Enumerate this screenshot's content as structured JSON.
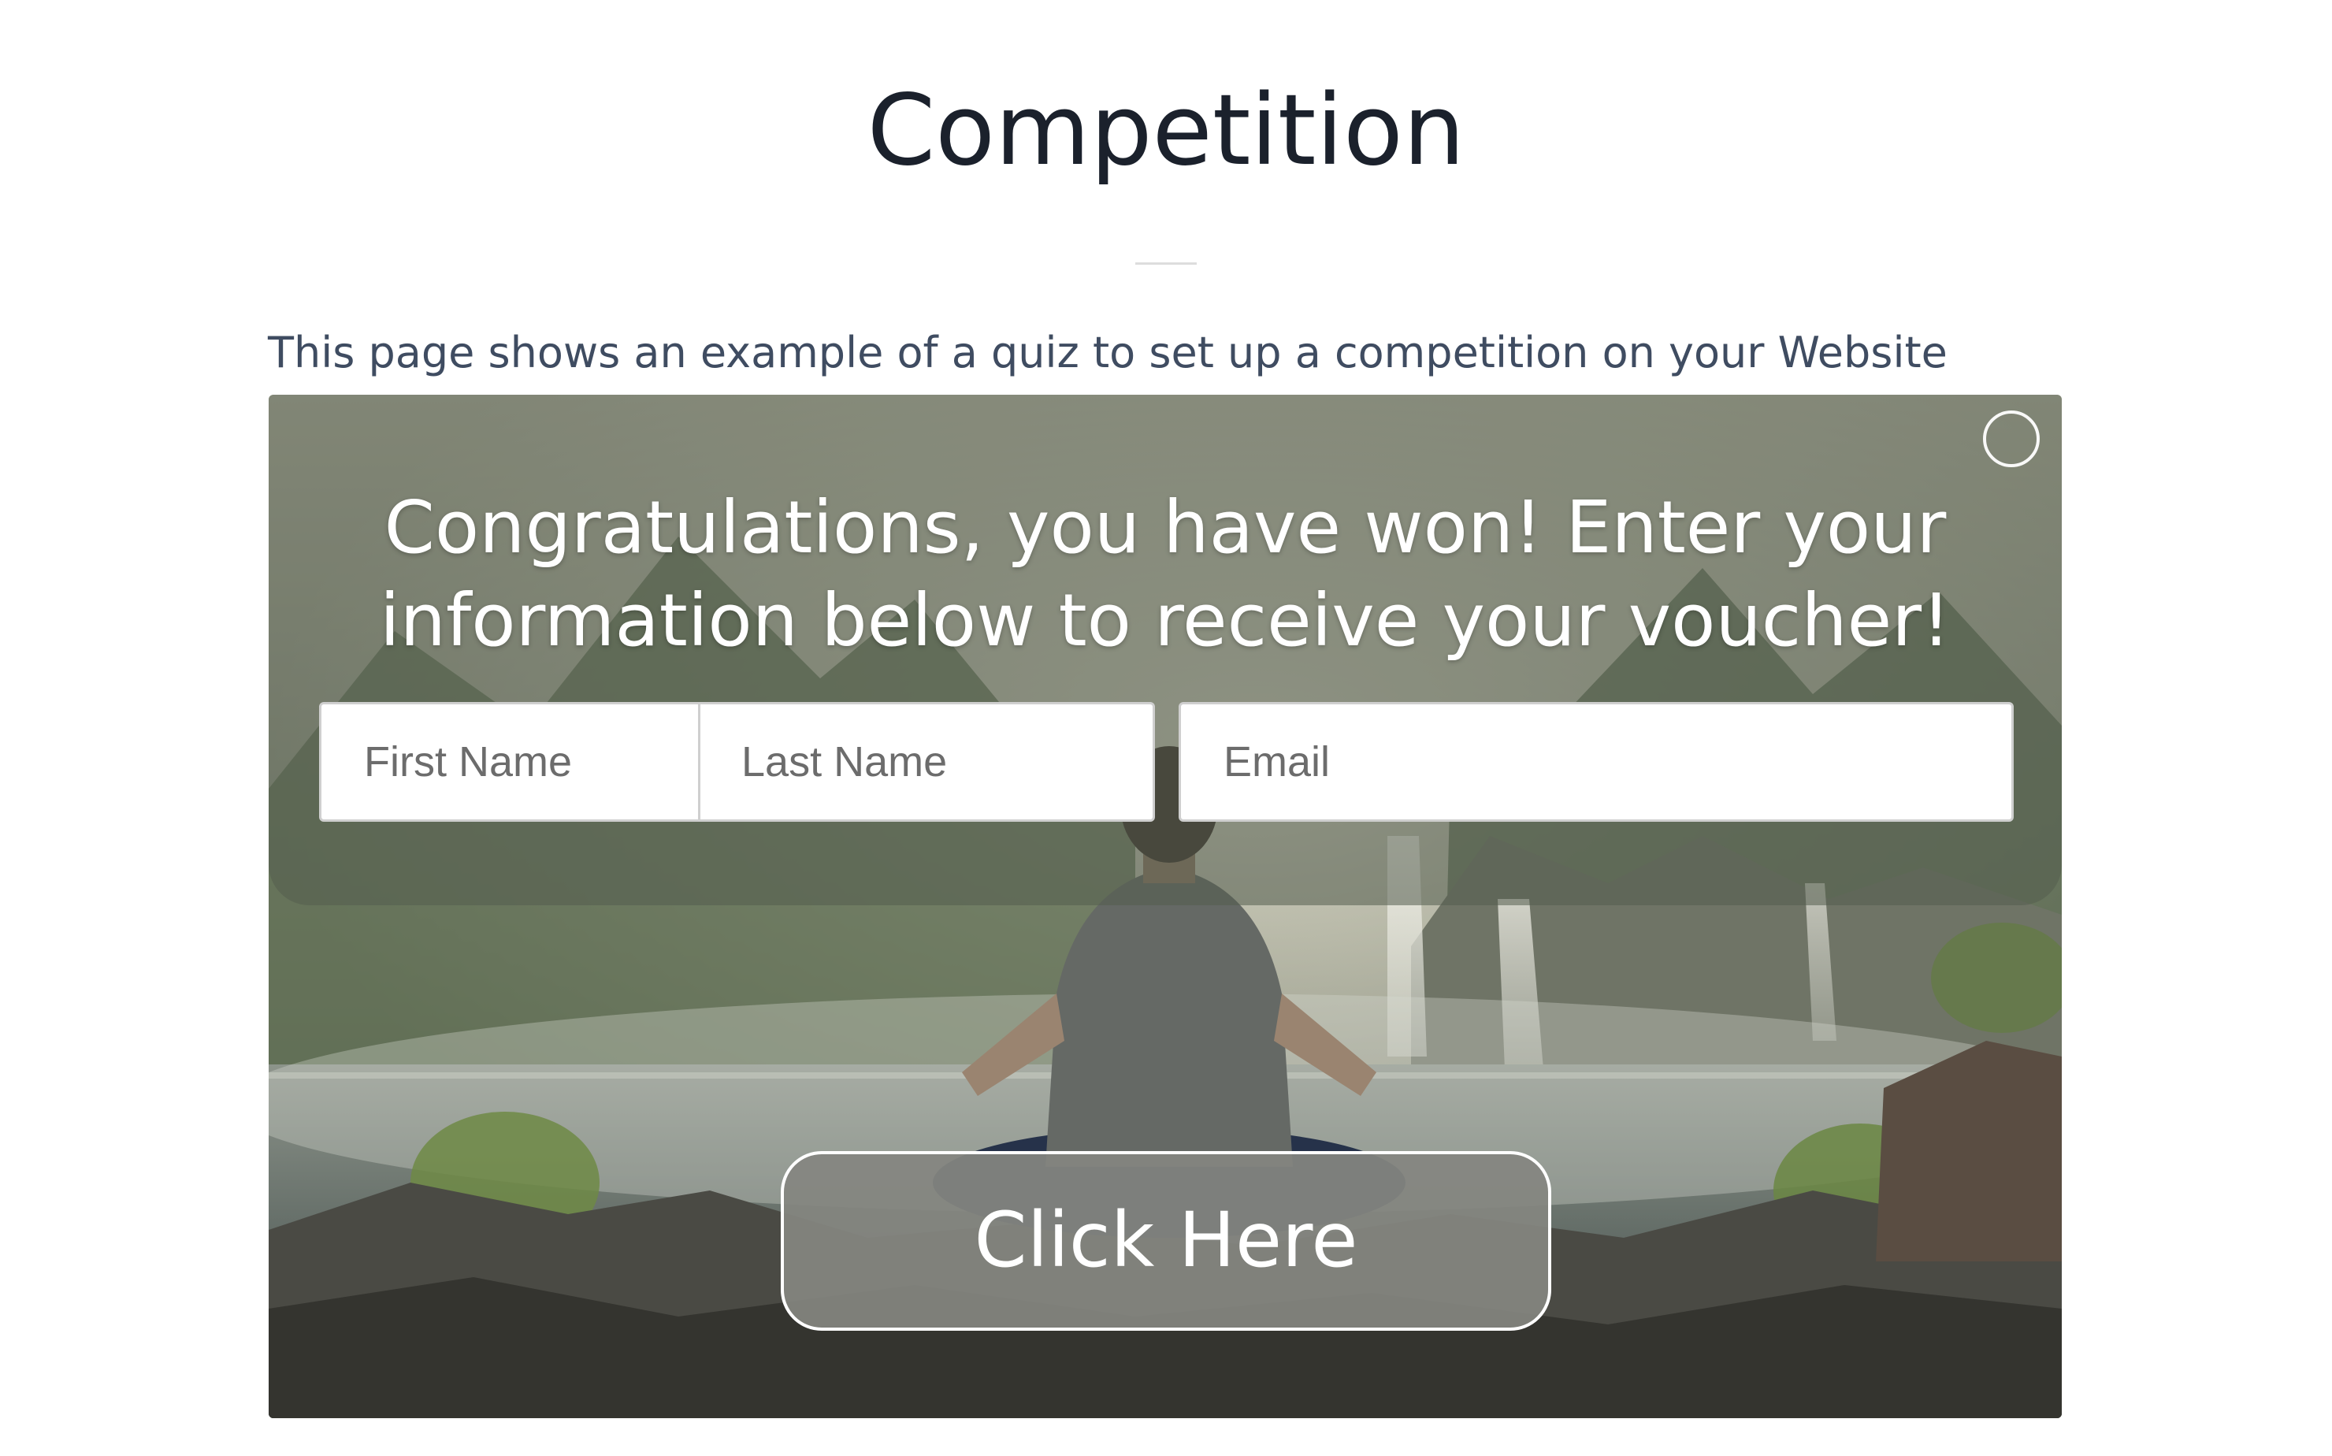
{
  "page": {
    "title": "Competition",
    "intro": "This page shows an example of a quiz to set up a competition on your Website"
  },
  "quiz": {
    "headline": "Congratulations, you have won! Enter your information below to receive your voucher!",
    "fields": {
      "first_name_placeholder": "First Name",
      "last_name_placeholder": "Last Name",
      "email_placeholder": "Email"
    },
    "cta_label": "Click Here",
    "close_icon": "close-circle-icon",
    "background_image": "meditating-person-by-waterfall-photo"
  },
  "colors": {
    "title": "#1b212c",
    "intro_text": "#3f4c61",
    "overlay": "#545c4e",
    "button": "#848680"
  }
}
